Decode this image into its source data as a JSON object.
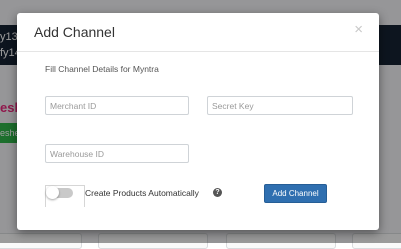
{
  "background": {
    "dark_bar_lines": [
      "y13",
      "fy14"
    ],
    "pink_text": "esh",
    "green_button_label": "eshe"
  },
  "modal": {
    "title": "Add Channel",
    "close_glyph": "×",
    "subtitle": "Fill Channel Details for Myntra",
    "fields": {
      "merchant_id": {
        "placeholder": "Merchant ID",
        "value": ""
      },
      "secret_key": {
        "placeholder": "Secret Key",
        "value": ""
      },
      "warehouse_id": {
        "placeholder": "Warehouse ID",
        "value": ""
      }
    },
    "toggle": {
      "label": "Create Products Automatically",
      "on": false
    },
    "help_glyph": "?",
    "submit_label": "Add Channel"
  },
  "colors": {
    "primary_button": "#2f6fb0",
    "dark_bar": "#152233",
    "pink_accent": "#e8287b",
    "green_accent": "#2fb34a"
  }
}
